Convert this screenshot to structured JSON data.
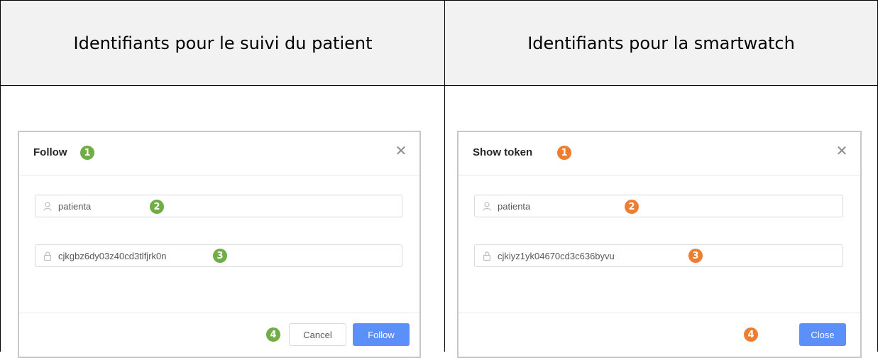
{
  "columns": [
    {
      "header": "Identifiants pour le suivi du patient"
    },
    {
      "header": "Identifiants pour la smartwatch"
    }
  ],
  "follow_modal": {
    "title": "Follow",
    "username": "patienta",
    "token": "cjkgbz6dy03z40cd3tlfjrk0n",
    "cancel_label": "Cancel",
    "follow_label": "Follow",
    "badge_color": "#70ad47",
    "badges": [
      "1",
      "2",
      "3",
      "4"
    ]
  },
  "token_modal": {
    "title": "Show token",
    "username": "patienta",
    "token": "cjkiyz1yk04670cd3c636byvu",
    "close_label": "Close",
    "badge_color": "#ed7d31",
    "badges": [
      "1",
      "2",
      "3",
      "4"
    ]
  },
  "colors": {
    "primary": "#5b8ff9",
    "header_bg": "#f2f2f2"
  }
}
